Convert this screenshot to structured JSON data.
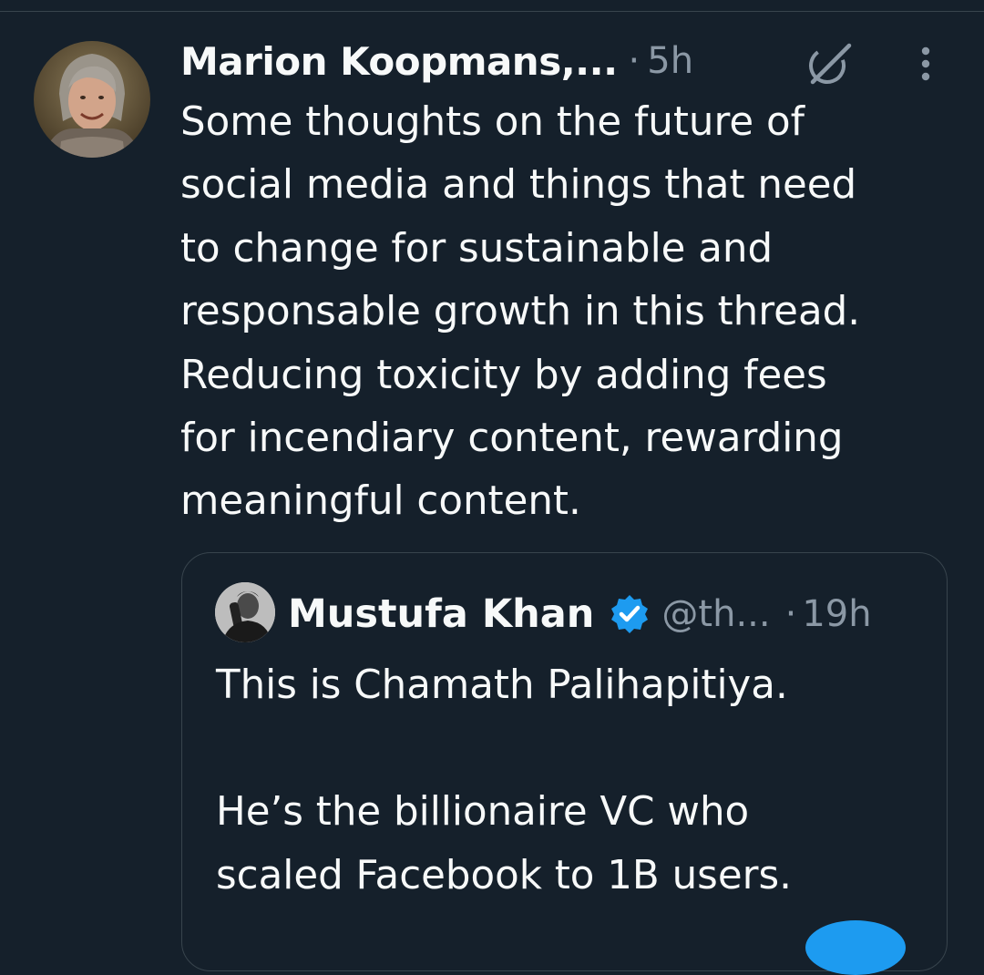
{
  "tweet": {
    "author": "Marion Koopmans,...",
    "separator": "·",
    "time": "5h",
    "text": "Some thoughts on the future of\nsocial media and things that need\nto change for sustainable and\nresponsable growth in this thread.\nReducing toxicity by adding fees\nfor incendiary content, rewarding\nmeaningful content.",
    "avatar_icon": "profile-photo",
    "grok_icon": "grok-icon",
    "more_icon": "more-vertical-icon"
  },
  "quote": {
    "author": "Mustufa Khan",
    "handle": "@th...",
    "separator": "·",
    "time": "19h",
    "verified_icon": "verified-badge-icon",
    "text": "This is Chamath Palihapitiya.\n\nHe’s the billionaire VC who\nscaled Facebook to 1B users."
  },
  "colors": {
    "background": "#15202b",
    "text": "#f7f9f9",
    "secondary": "#8b98a5",
    "border": "#38444d",
    "accent": "#1d9bf0"
  }
}
